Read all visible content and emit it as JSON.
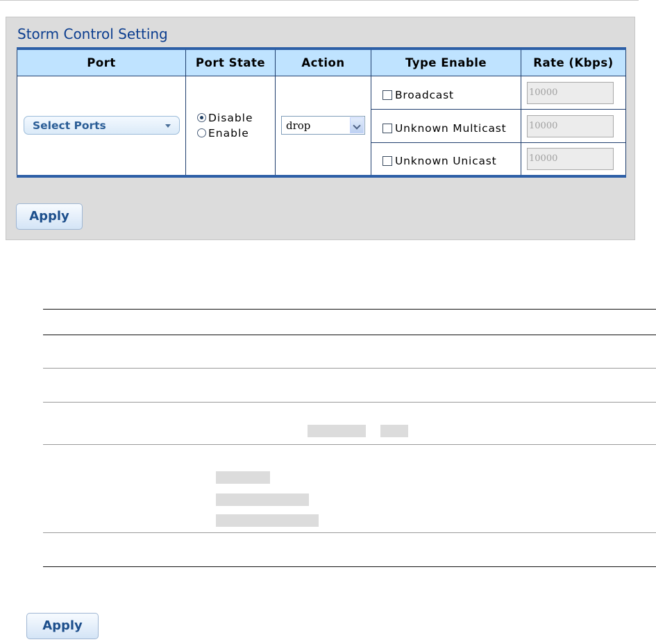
{
  "panel": {
    "title": "Storm Control Setting",
    "columns": [
      "Port",
      "Port State",
      "Action",
      "Type Enable",
      "Rate (Kbps)"
    ],
    "port_select_label": "Select Ports",
    "port_state_options": [
      {
        "label": "Disable",
        "selected": true
      },
      {
        "label": "Enable",
        "selected": false
      }
    ],
    "action_value": "drop",
    "types": [
      {
        "label": "Broadcast",
        "checked": false,
        "rate": "10000"
      },
      {
        "label": "Unknown Multicast",
        "checked": false,
        "rate": "10000"
      },
      {
        "label": "Unknown Unicast",
        "checked": false,
        "rate": "10000"
      }
    ],
    "apply_label": "Apply"
  },
  "footer": {
    "apply_label": "Apply"
  },
  "colors": {
    "title": "#0b3d8f",
    "header_bg": "#bfe3ff",
    "table_border": "#2d5fa6",
    "panel_bg": "#dcdcdc"
  }
}
